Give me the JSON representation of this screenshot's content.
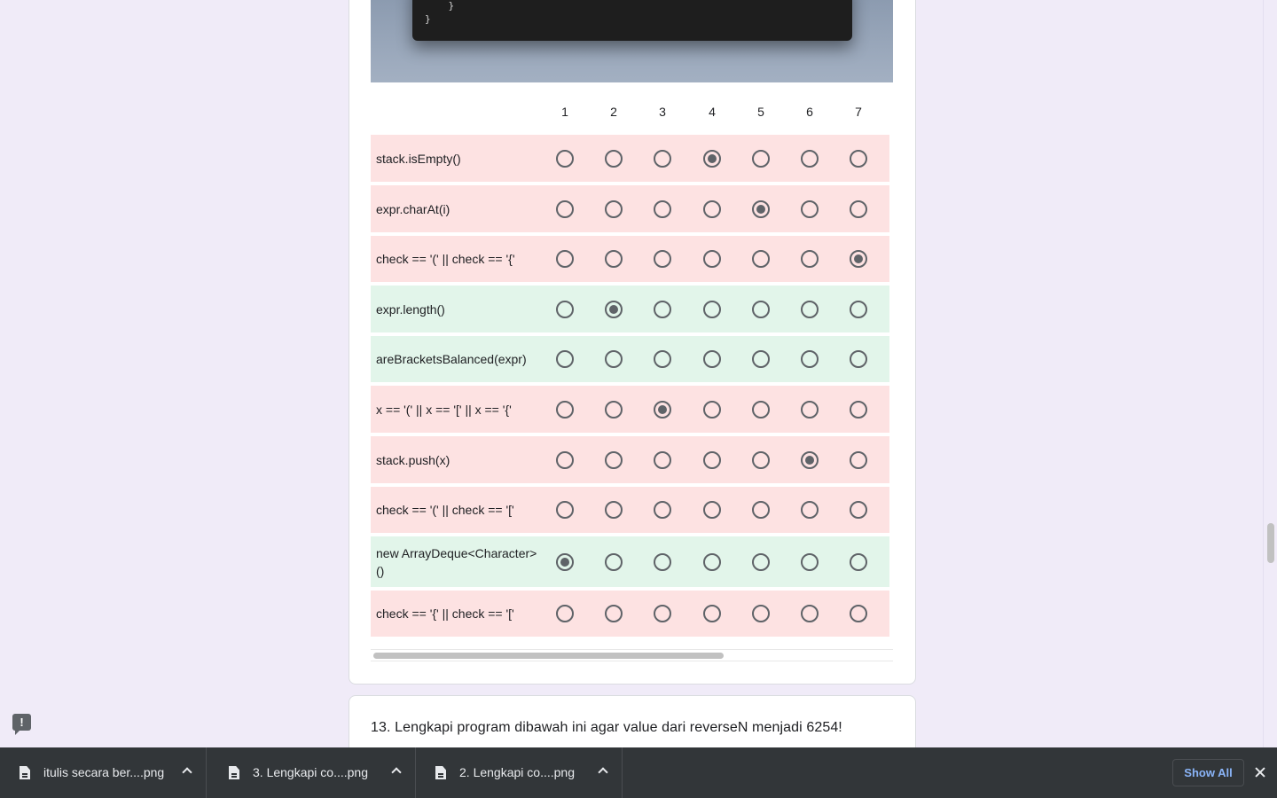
{
  "code_snippet": {
    "lines": [
      "    }",
      "}"
    ]
  },
  "grid": {
    "columns": [
      "1",
      "2",
      "3",
      "4",
      "5",
      "6",
      "7"
    ],
    "rows": [
      {
        "label": "stack.isEmpty()",
        "selected": 4,
        "status": "incorrect",
        "status_color": "#fde2e2"
      },
      {
        "label": "expr.charAt(i)",
        "selected": 5,
        "status": "incorrect",
        "status_color": "#fde2e2"
      },
      {
        "label": "check == '(' || check == '{'",
        "selected": 7,
        "status": "incorrect",
        "status_color": "#fde2e2"
      },
      {
        "label": "expr.length()",
        "selected": 2,
        "status": "correct",
        "status_color": "#e2f5ea"
      },
      {
        "label": "areBracketsBalanced(expr)",
        "selected": null,
        "status": "correct",
        "status_color": "#e2f5ea"
      },
      {
        "label": "x == '(' || x == '[' || x == '{'",
        "selected": 3,
        "status": "incorrect",
        "status_color": "#fde2e2"
      },
      {
        "label": "stack.push(x)",
        "selected": 6,
        "status": "incorrect",
        "status_color": "#fde2e2"
      },
      {
        "label": "check == '(' || check == '['",
        "selected": null,
        "status": "incorrect",
        "status_color": "#fde2e2"
      },
      {
        "label": "new ArrayDeque<Character>()",
        "selected": 1,
        "status": "correct",
        "status_color": "#e2f5ea"
      },
      {
        "label": "check == '{' || check == '['",
        "selected": null,
        "status": "incorrect",
        "status_color": "#fde2e2"
      }
    ]
  },
  "next_question": {
    "text": "13. Lengkapi program dibawah ini agar value dari reverseN menjadi 6254!"
  },
  "downloads_bar": {
    "items": [
      {
        "name": "itulis secara ber....png",
        "icon": "file-icon"
      },
      {
        "name": "3. Lengkapi co....png",
        "icon": "file-icon"
      },
      {
        "name": "2. Lengkapi co....png",
        "icon": "file-icon"
      }
    ],
    "show_all_label": "Show All"
  },
  "feedback_icon_glyph": "!",
  "colors": {
    "page_background": "#f0ebf8",
    "incorrect_row": "#fde2e2",
    "correct_row": "#e2f5ea",
    "radio": "#5f6368",
    "downloads_background": "#323639",
    "show_all_text": "#8ab4f8"
  }
}
